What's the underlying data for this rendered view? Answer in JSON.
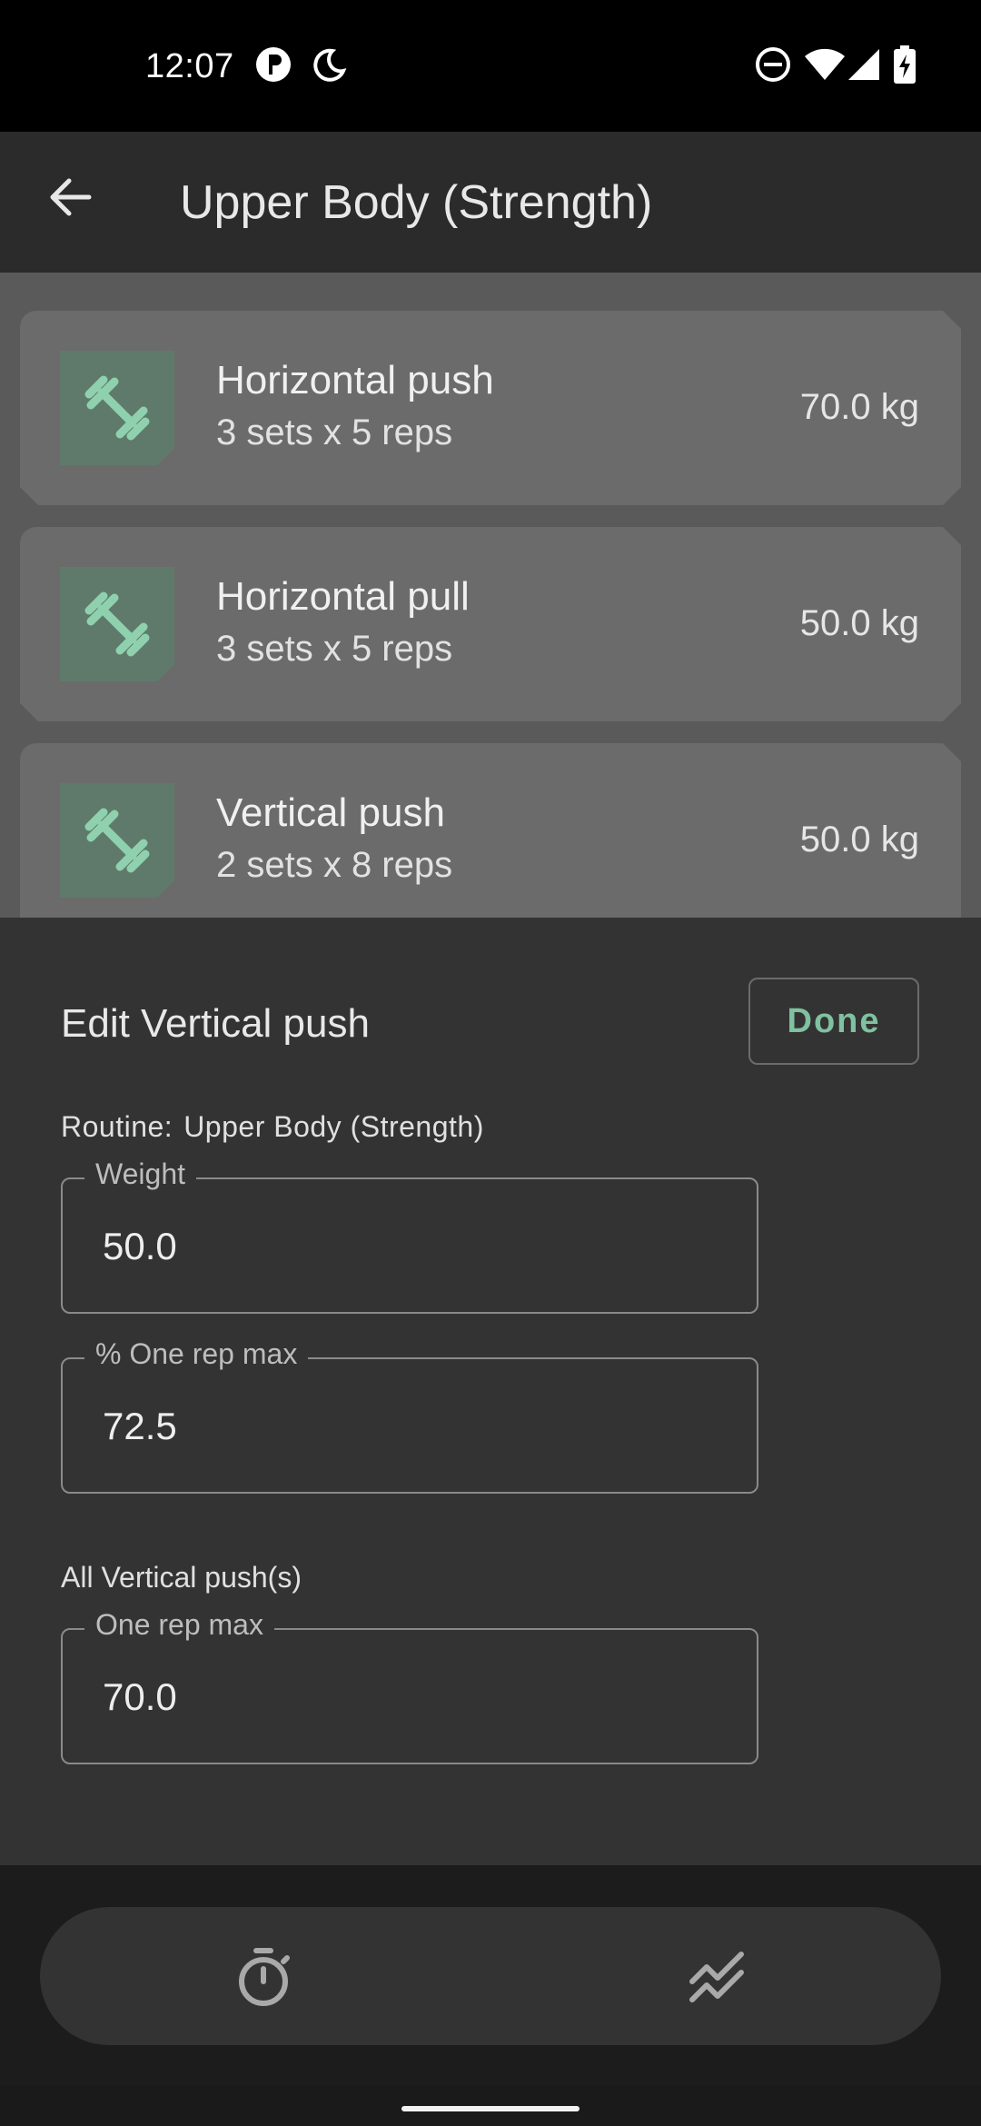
{
  "status_bar": {
    "time": "12:07",
    "icons": [
      "notification-p-icon",
      "moon-icon",
      "do-not-disturb-icon",
      "wifi-icon",
      "signal-icon",
      "battery-charging-icon"
    ]
  },
  "app_bar": {
    "title": "Upper Body (Strength)",
    "back_icon": "arrow-left-icon"
  },
  "exercises": [
    {
      "name": "Horizontal push",
      "detail": "3 sets x 5 reps",
      "weight": "70.0 kg",
      "icon": "dumbbell-icon"
    },
    {
      "name": "Horizontal pull",
      "detail": "3 sets x 5 reps",
      "weight": "50.0 kg",
      "icon": "dumbbell-icon"
    },
    {
      "name": "Vertical push",
      "detail": "2 sets x 8 reps",
      "weight": "50.0 kg",
      "icon": "dumbbell-icon"
    }
  ],
  "sheet": {
    "title": "Edit Vertical push",
    "done_label": "Done",
    "routine_label": "Routine:",
    "routine_value": "Upper Body (Strength)",
    "weight": {
      "label": "Weight",
      "value": "50.0"
    },
    "percent_orm": {
      "label": "% One rep max",
      "value": "72.5"
    },
    "all_label": "All Vertical push(s)",
    "orm": {
      "label": "One rep max",
      "value": "70.0"
    }
  },
  "nav": {
    "items": [
      "timer-icon",
      "chart-trend-icon"
    ]
  },
  "colors": {
    "accent": "#7fc1a0",
    "sheet_bg": "#333333",
    "app_bar_bg": "#2b2b2b"
  }
}
